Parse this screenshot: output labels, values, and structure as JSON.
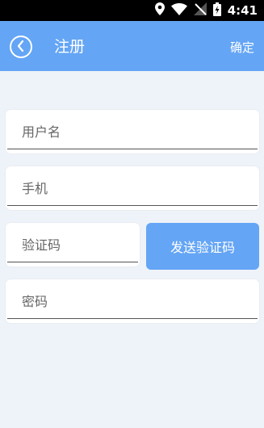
{
  "status_bar": {
    "time": "4:41"
  },
  "header": {
    "title": "注册",
    "confirm_label": "确定"
  },
  "form": {
    "username_placeholder": "用户名",
    "phone_placeholder": "手机",
    "code_placeholder": "验证码",
    "password_placeholder": "密码",
    "send_code_label": "发送验证码"
  },
  "colors": {
    "accent": "#64a5f5",
    "background": "#eef3f9"
  },
  "icons": [
    "location-icon",
    "wifi-icon",
    "no-signal-icon",
    "battery-icon",
    "back-icon"
  ]
}
